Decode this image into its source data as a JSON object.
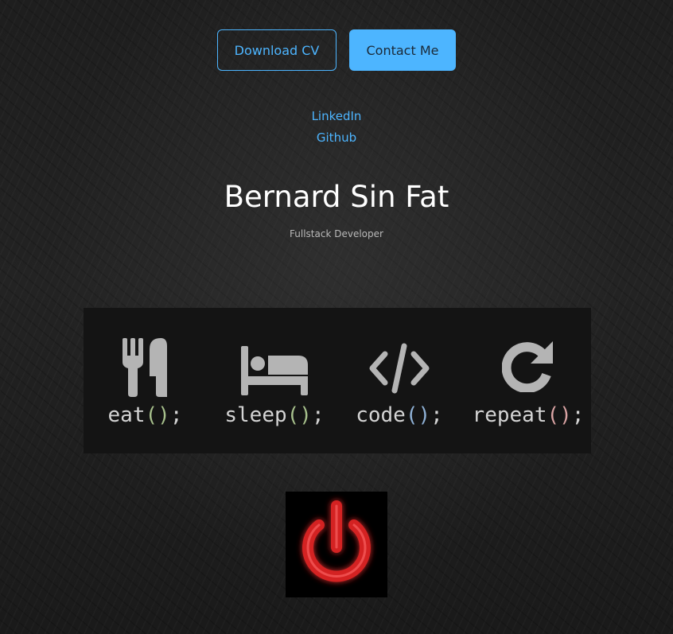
{
  "actions": {
    "download_cv": "Download CV",
    "contact_me": "Contact Me"
  },
  "socials": {
    "linkedin": "LinkedIn",
    "github": "Github"
  },
  "profile": {
    "name": "Bernard Sin Fat",
    "title": "Fullstack Developer"
  },
  "banner": {
    "items": [
      {
        "word": "eat",
        "parens": "()",
        "semicolon": ";",
        "icon": "fork-knife-icon"
      },
      {
        "word": "sleep",
        "parens": "()",
        "semicolon": ";",
        "icon": "bed-icon"
      },
      {
        "word": "code",
        "parens": "()",
        "semicolon": ";",
        "icon": "code-icon"
      },
      {
        "word": "repeat",
        "parens": "()",
        "semicolon": ";",
        "icon": "redo-icon"
      }
    ]
  },
  "colors": {
    "accent": "#4db5ff",
    "power_red": "#e02a2a"
  },
  "power_icon": "power-icon"
}
